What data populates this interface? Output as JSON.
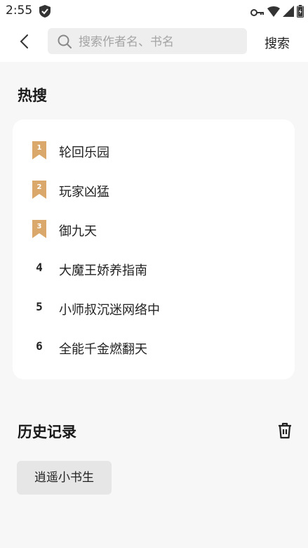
{
  "status_bar": {
    "time": "2:55"
  },
  "search": {
    "placeholder": "搜索作者名、书名",
    "value": "",
    "button_label": "搜索"
  },
  "hot": {
    "title": "热搜",
    "items": [
      {
        "rank": "1",
        "name": "轮回乐园"
      },
      {
        "rank": "2",
        "name": "玩家凶猛"
      },
      {
        "rank": "3",
        "name": "御九天"
      },
      {
        "rank": "4",
        "name": "大魔王娇养指南"
      },
      {
        "rank": "5",
        "name": "小师叔沉迷网络中"
      },
      {
        "rank": "6",
        "name": "全能千金燃翻天"
      }
    ],
    "badge_color": "#d9a86a"
  },
  "history": {
    "title": "历史记录",
    "items": [
      "逍遥小书生"
    ]
  }
}
